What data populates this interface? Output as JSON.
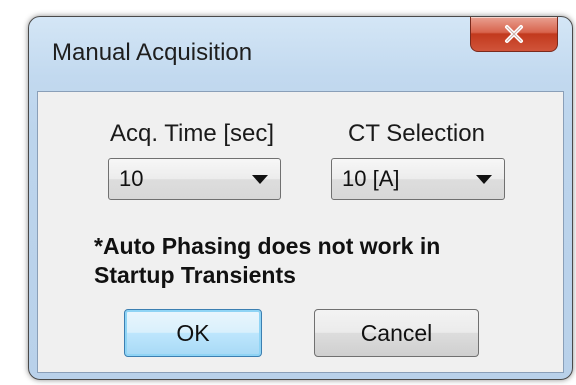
{
  "window": {
    "title": "Manual Acquisition",
    "close_icon": "close-x-icon"
  },
  "acq_time": {
    "label": "Acq. Time [sec]",
    "value": "10"
  },
  "ct_selection": {
    "label": "CT Selection",
    "value": "10 [A]"
  },
  "note": {
    "line1": "*Auto Phasing does not work in",
    "line2": "Startup Transients"
  },
  "buttons": {
    "ok": "OK",
    "cancel": "Cancel"
  },
  "colors": {
    "close_button": "#c2391d",
    "default_button_border": "#3c7fb1",
    "client_bg": "#f0f0f0"
  }
}
